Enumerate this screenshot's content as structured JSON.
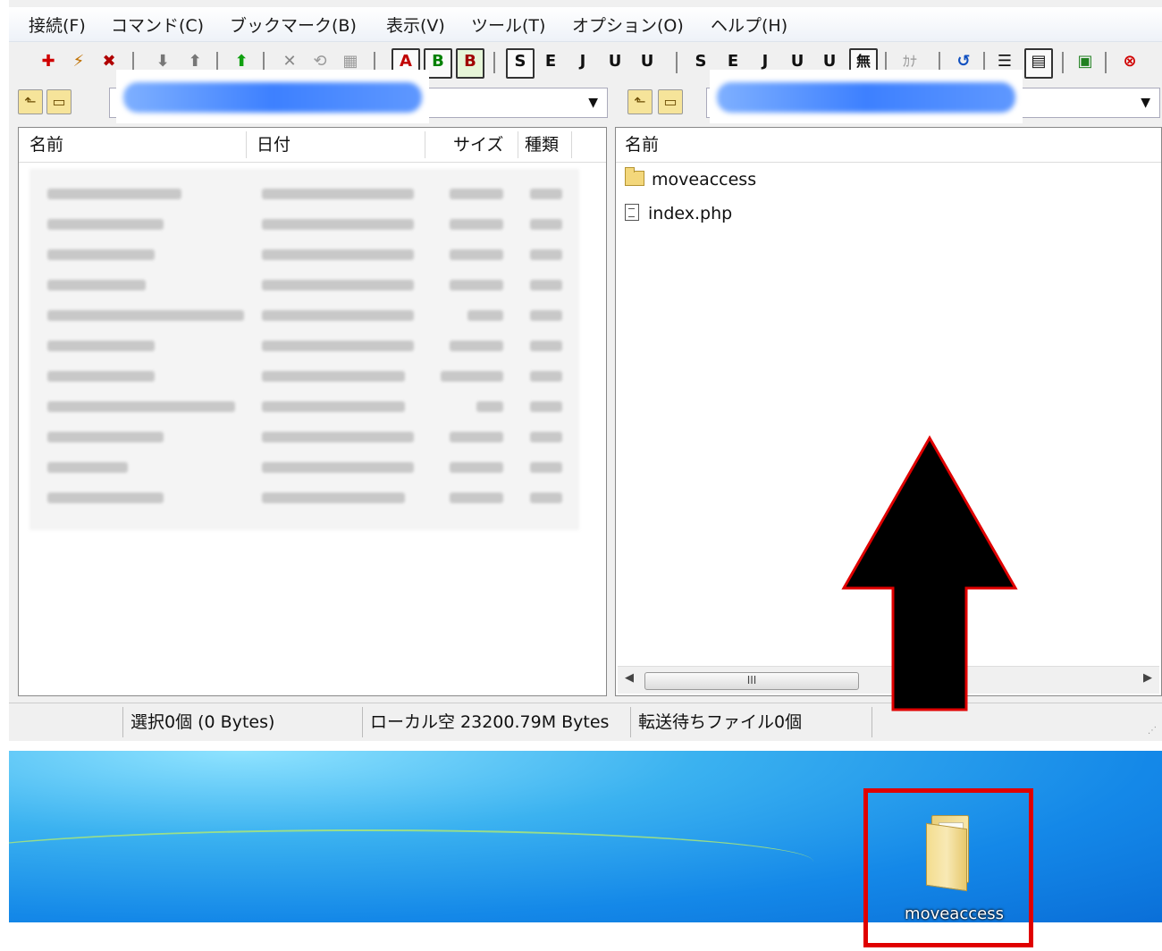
{
  "menu": [
    "接続(F)",
    "コマンド(C)",
    "ブックマーク(B)",
    "表示(V)",
    "ツール(T)",
    "オプション(O)",
    "ヘルプ(H)"
  ],
  "toolbar": {
    "connect_icon": "plug-icon",
    "quick_connect_icon": "lightning-icon",
    "disconnect_icon": "disconnect-icon",
    "mode_a": "A",
    "mode_b": "B",
    "mode_auto": "B",
    "kanji_host_labels": [
      "S",
      "E",
      "J",
      "U",
      "U"
    ],
    "kanji_local_labels": [
      "S",
      "E",
      "J",
      "U",
      "U"
    ],
    "no_conv": "無",
    "kana": "ｶﾅ"
  },
  "local": {
    "columns": [
      "名前",
      "日付",
      "サイズ",
      "種類"
    ]
  },
  "remote": {
    "columns": [
      "名前"
    ],
    "files": [
      {
        "name": "moveaccess",
        "type": "folder"
      },
      {
        "name": "index.php",
        "type": "file"
      }
    ],
    "scroll_thumb": "III"
  },
  "status": {
    "selection": "選択0個 (0 Bytes)",
    "local_free": "ローカル空 23200.79M Bytes",
    "queue": "転送待ちファイル0個"
  },
  "desktop": {
    "icon_label": "moveaccess"
  },
  "colors": {
    "highlight": "#e00000",
    "arrow_fill": "#000000",
    "arrow_outline": "#e00000",
    "desktop": "#1488e8"
  }
}
